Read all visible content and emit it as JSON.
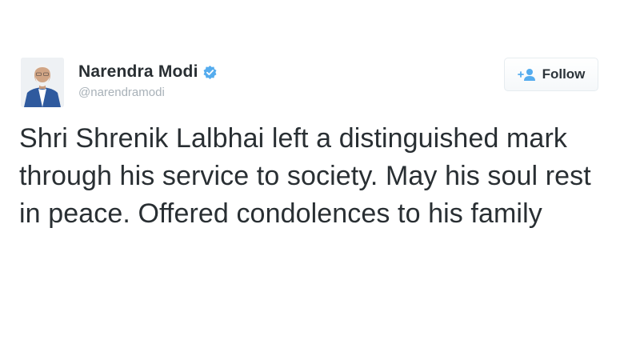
{
  "author": {
    "name": "Narendra Modi",
    "handle": "@narendramodi",
    "verified": true,
    "avatar_icon": "person-portrait-icon"
  },
  "follow_button": {
    "label": "Follow",
    "icon": "add-user-icon"
  },
  "tweet": {
    "text": "Shri Shrenik Lalbhai left a distinguished mark through his service to society. May his soul rest in peace. Offered condolences to his family"
  },
  "colors": {
    "verified_badge": "#55acee",
    "follow_icon": "#55acee",
    "text": "#292f33",
    "handle": "#a8b1b8"
  }
}
